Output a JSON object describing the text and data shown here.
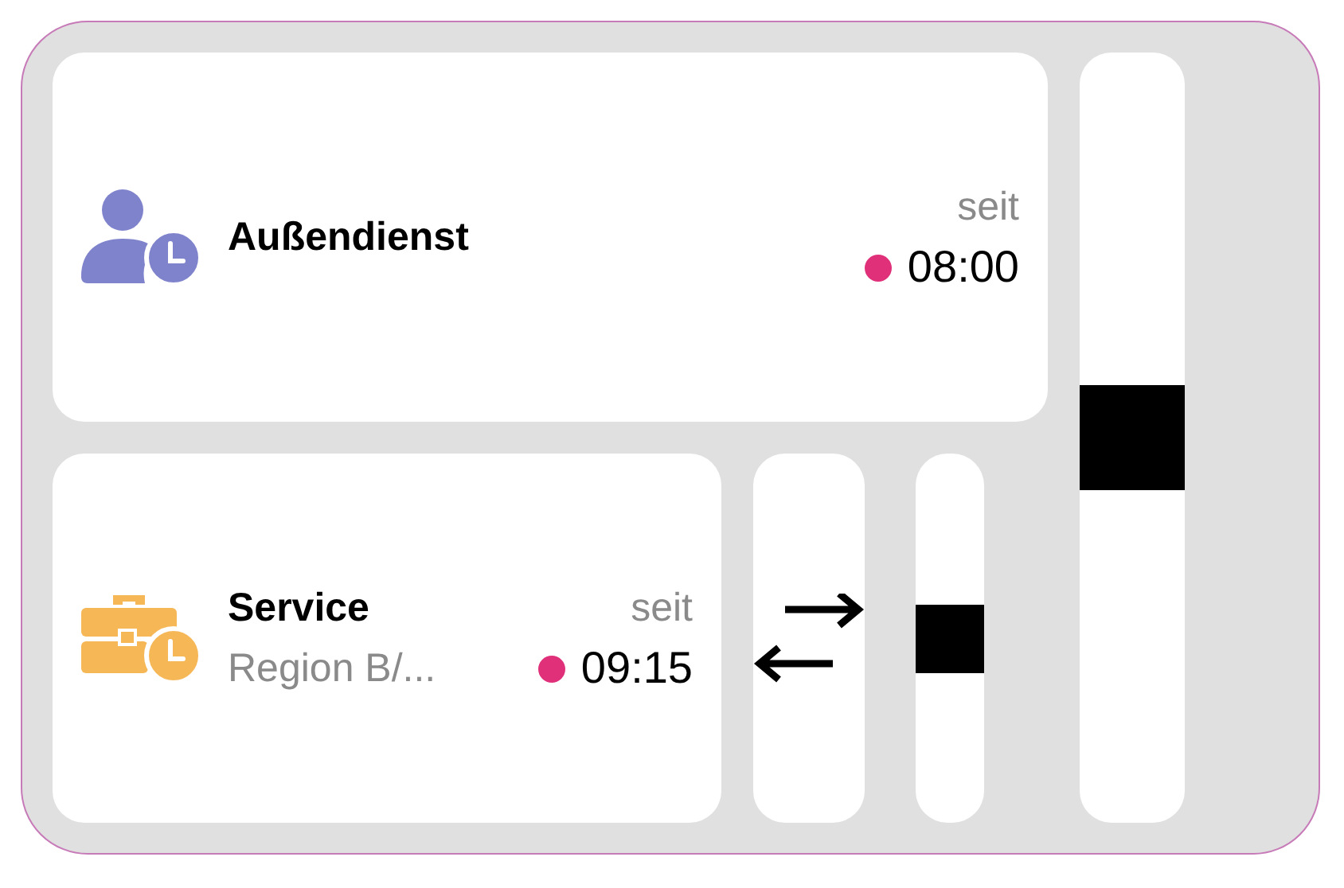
{
  "activities": [
    {
      "kind": "person",
      "title": "Außendienst",
      "since_label": "seit",
      "time": "08:00",
      "color": "#e0307a"
    },
    {
      "kind": "briefcase",
      "title": "Service",
      "subtitle": "Region B/...",
      "since_label": "seit",
      "time": "09:15",
      "color": "#e0307a"
    }
  ],
  "buttons": [
    {
      "kind": "swap"
    },
    {
      "kind": "stop"
    },
    {
      "kind": "stop"
    }
  ]
}
